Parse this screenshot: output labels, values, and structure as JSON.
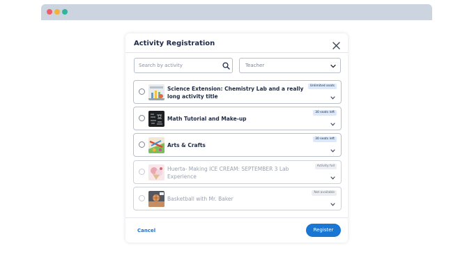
{
  "window": {
    "controls": [
      "close",
      "minimize",
      "maximize"
    ],
    "colors": {
      "close": "#ee5e6a",
      "minimize": "#f2b33d",
      "maximize": "#2fb59b"
    }
  },
  "modal": {
    "title": "Activity Registration",
    "close_icon": "close-icon"
  },
  "filters": {
    "search": {
      "placeholder": "Search by activity",
      "value": "",
      "icon": "search-icon"
    },
    "teacher": {
      "selected": "Teacher",
      "icon": "chevron-down-icon"
    }
  },
  "activities": [
    {
      "title": "Science Extension: Chemistry Lab and a really long activity title",
      "badge": "Unlimited seats",
      "status": "available",
      "thumbnail": "chemistry-lab-image"
    },
    {
      "title": "Math Tutorial and Make-up",
      "badge": "30 seats left",
      "status": "available",
      "thumbnail": "math-chalkboard-image"
    },
    {
      "title": "Arts & Crafts",
      "badge": "30 seats left",
      "status": "available",
      "thumbnail": "arts-crafts-image"
    },
    {
      "title": "Huerta- Making ICE CREAM: SEPTEMBER 3 Lab Experience",
      "badge": "Activity full",
      "status": "disabled",
      "thumbnail": "ice-cream-image"
    },
    {
      "title": "Basketball with Mr. Baker",
      "badge": "Not available",
      "status": "disabled",
      "thumbnail": "basketball-image"
    }
  ],
  "footer": {
    "cancel_label": "Cancel",
    "register_label": "Register",
    "accent_color": "#1976d2"
  }
}
